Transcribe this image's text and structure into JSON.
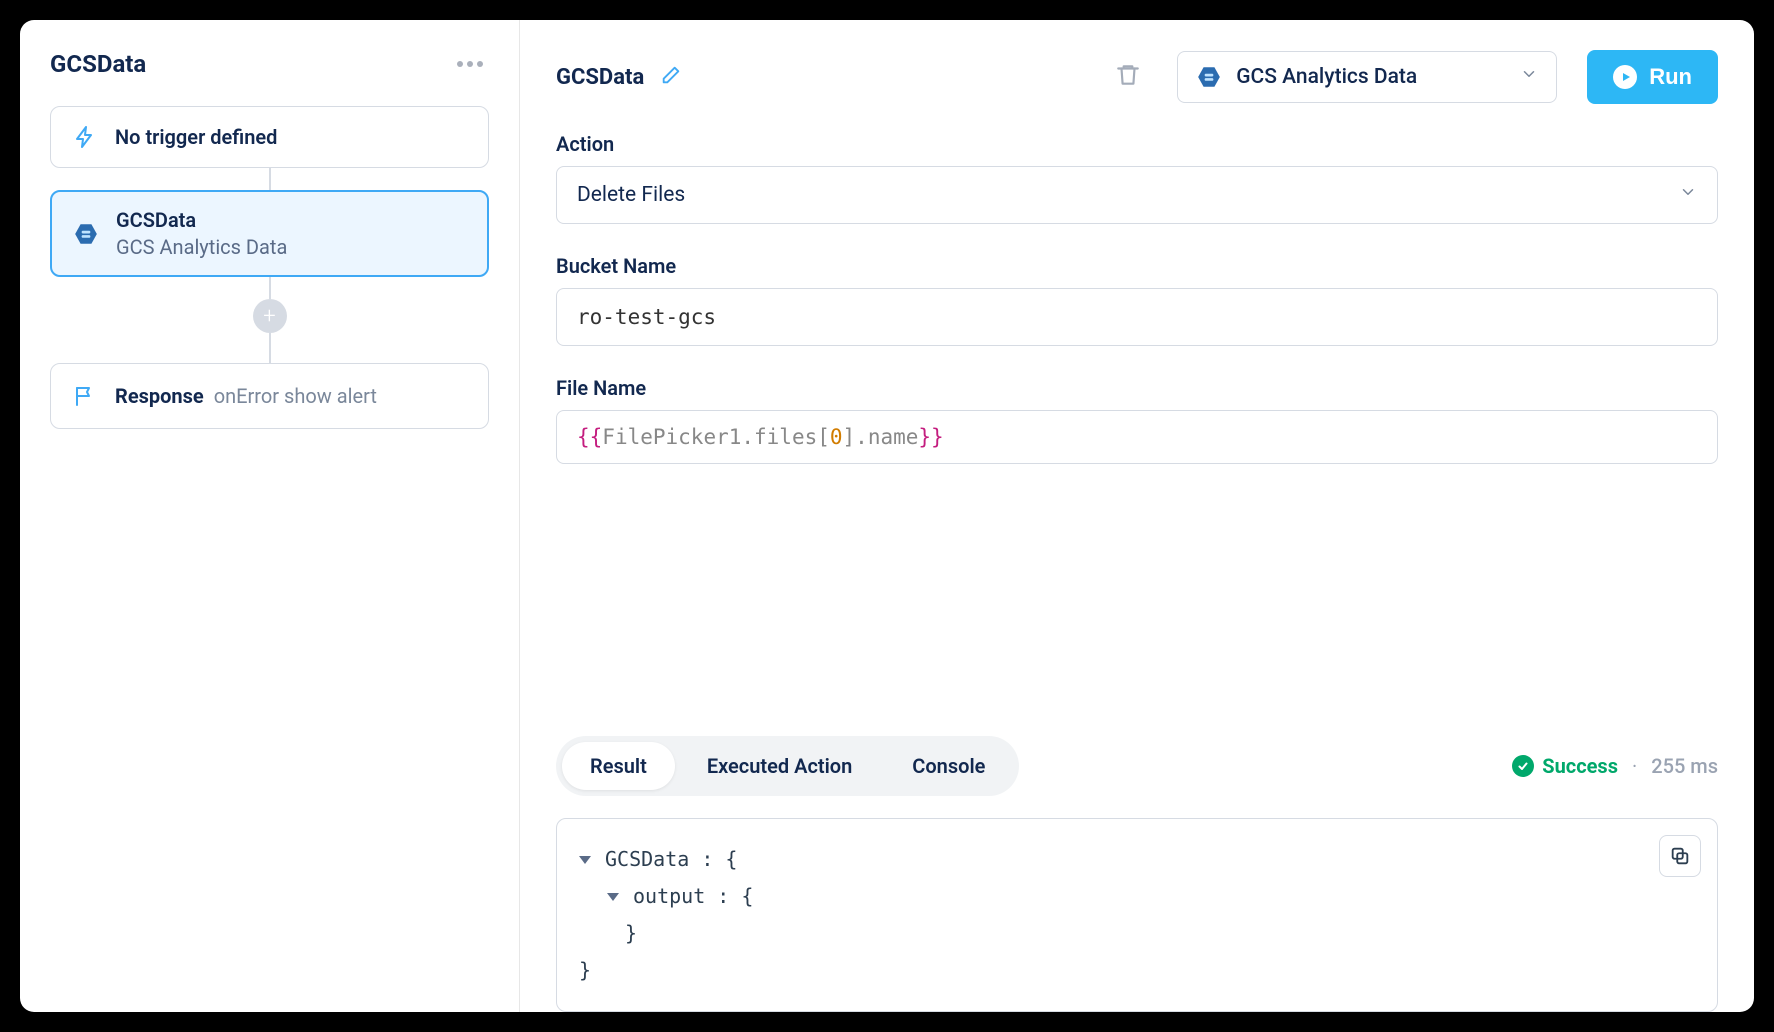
{
  "sidebar": {
    "title": "GCSData",
    "trigger_label": "No trigger defined",
    "step": {
      "title": "GCSData",
      "subtitle": "GCS Analytics Data"
    },
    "response": {
      "label": "Response",
      "sub": "onError show alert"
    }
  },
  "topbar": {
    "title": "GCSData",
    "resource": "GCS Analytics Data",
    "run_label": "Run"
  },
  "form": {
    "action_label": "Action",
    "action_value": "Delete Files",
    "bucket_label": "Bucket Name",
    "bucket_value": "ro-test-gcs",
    "file_label": "File Name",
    "file_expr_open": "{{",
    "file_expr_a": "FilePicker1.files[",
    "file_expr_num": "0",
    "file_expr_b": "].name",
    "file_expr_close": "}}"
  },
  "tabs": {
    "result": "Result",
    "executed": "Executed Action",
    "console": "Console"
  },
  "status": {
    "label": "Success",
    "time": "255 ms"
  },
  "result": {
    "root_key": "GCSData",
    "child_key": "output"
  }
}
